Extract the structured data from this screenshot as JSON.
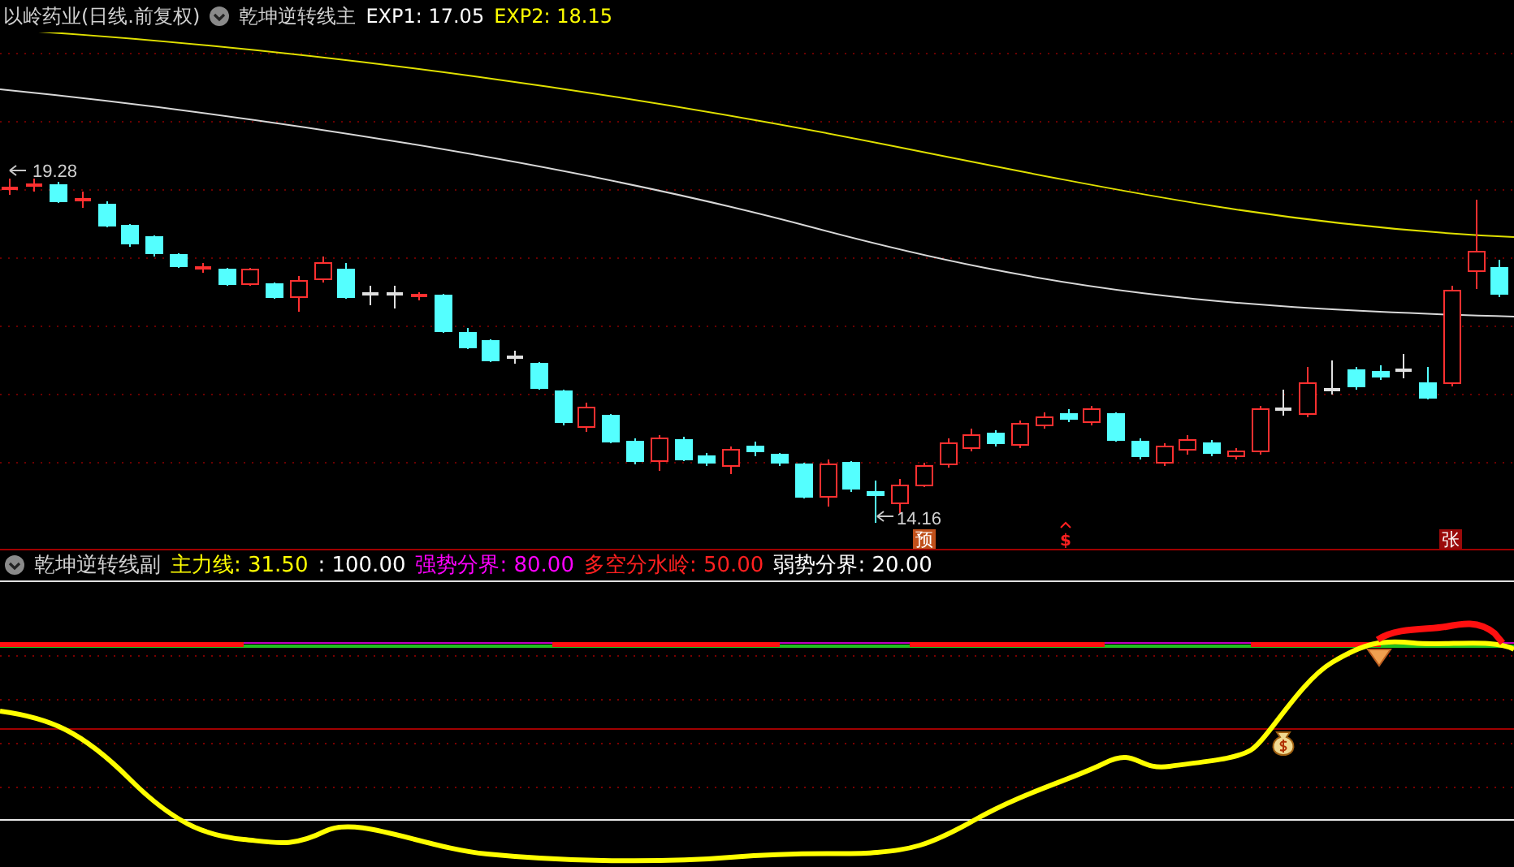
{
  "header": {
    "title": "以岭药业(日线.前复权)",
    "indicator": "乾坤逆转线主",
    "values": [
      {
        "text": "EXP1: 17.05",
        "color": "#ffffff"
      },
      {
        "text": "EXP2: 18.15",
        "color": "#ffff00"
      }
    ]
  },
  "main_chart": {
    "price_labels": [
      {
        "text": "19.28"
      },
      {
        "text": "14.16"
      }
    ],
    "signals": [
      {
        "kind": "badge",
        "text": "预",
        "color": "#c0501a"
      },
      {
        "kind": "arrow",
        "text": "$",
        "color": "#ff2020"
      },
      {
        "kind": "badge",
        "text": "张",
        "color": "#9a0a0a"
      }
    ]
  },
  "sub_panel": {
    "indicator": "乾坤逆转线副",
    "values": [
      {
        "text": "主力线: 31.50",
        "color": "#ffff00"
      },
      {
        "text": ": 100.00",
        "color": "#ffffff"
      },
      {
        "text": "强势分界: 80.00",
        "color": "#ff00ff"
      },
      {
        "text": "多空分水岭: 50.00",
        "color": "#ff2020"
      },
      {
        "text": "弱势分界: 20.00",
        "color": "#ffffff"
      }
    ]
  }
}
